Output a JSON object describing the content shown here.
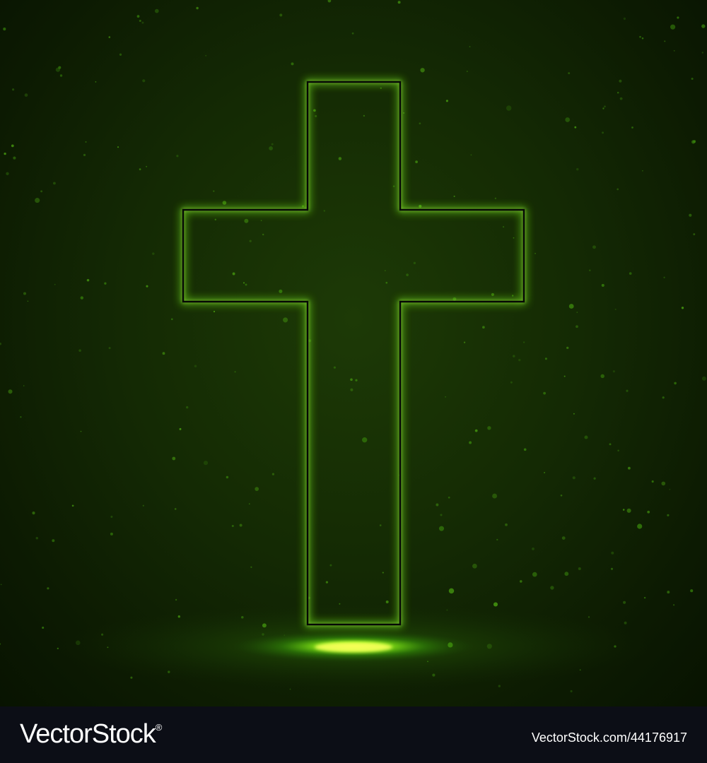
{
  "artwork": {
    "subject": "glowing-cross",
    "background_color": "#142a04",
    "glow_color": "#7dff1a",
    "outline_color": "#050805"
  },
  "footer": {
    "brand_name": "VectorStock",
    "registered_mark": "®",
    "image_reference": "VectorStock.com/44176917",
    "background_color": "#0c0e16"
  }
}
